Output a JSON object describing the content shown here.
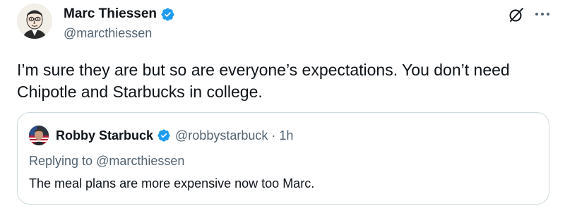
{
  "author": {
    "display_name": "Marc Thiessen",
    "handle": "@marcthiessen",
    "avatar_icon": "caricature-avatar",
    "verified_color": "#1d9bf0"
  },
  "actions": {
    "grok_icon": "grok-icon",
    "more_icon": "more-horizontal-icon"
  },
  "tweet": {
    "text": "I’m sure they are but so are everyone’s expectations. You don’t need Chipotle and Starbucks in college."
  },
  "quoted_tweet": {
    "display_name": "Robby Starbuck",
    "handle": "@robbystarbuck",
    "separator": "·",
    "time": "1h",
    "replying_prefix": "Replying to",
    "replying_to": "@marcthiessen",
    "text": "The meal plans are more expensive now too Marc."
  },
  "colors": {
    "text_primary": "#0f1419",
    "text_secondary": "#536471",
    "border": "#cfd9de",
    "verified_blue": "#1d9bf0"
  }
}
